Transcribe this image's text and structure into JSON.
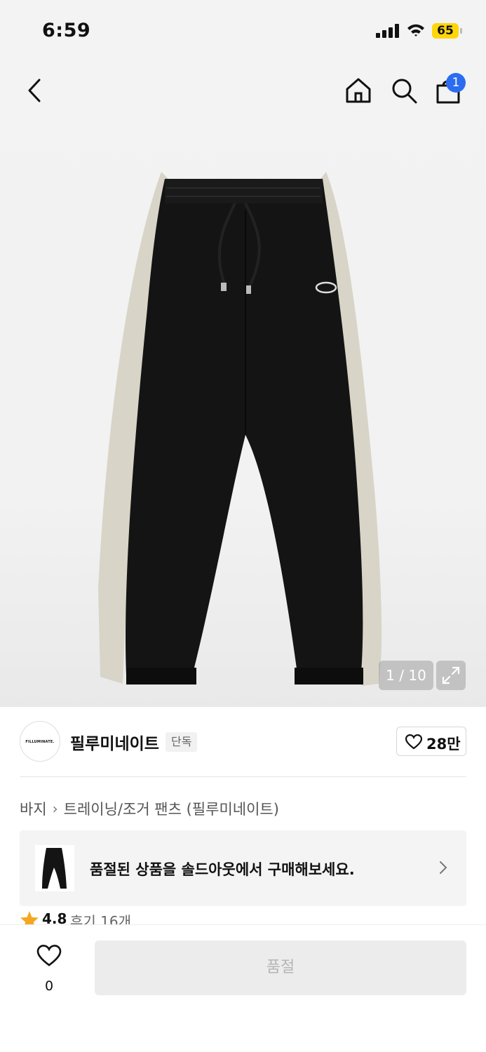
{
  "status_bar": {
    "time": "6:59",
    "battery": "65"
  },
  "nav": {
    "cart_count": "1"
  },
  "gallery": {
    "counter": "1 / 10"
  },
  "brand": {
    "logo_text": "FILLUMINATE.",
    "name": "필루미네이트",
    "badge": "단독",
    "like_count": "28만"
  },
  "breadcrumb": {
    "items": [
      "바지",
      "트레이닝/조거 팬츠 (필루미네이트)"
    ]
  },
  "soldout_card": {
    "text": "품절된 상품을 솔드아웃에서 구매해보세요."
  },
  "rating": {
    "value": "4.8",
    "reviews": "후기 16개"
  },
  "bottom_bar": {
    "wish_count": "0",
    "buy_label": "품절"
  },
  "colors": {
    "accent_blue": "#2b6cf0",
    "battery": "#ffd60a",
    "star": "#f5a623",
    "pants_body": "#111111",
    "pants_stripe": "#d8d4c8"
  }
}
